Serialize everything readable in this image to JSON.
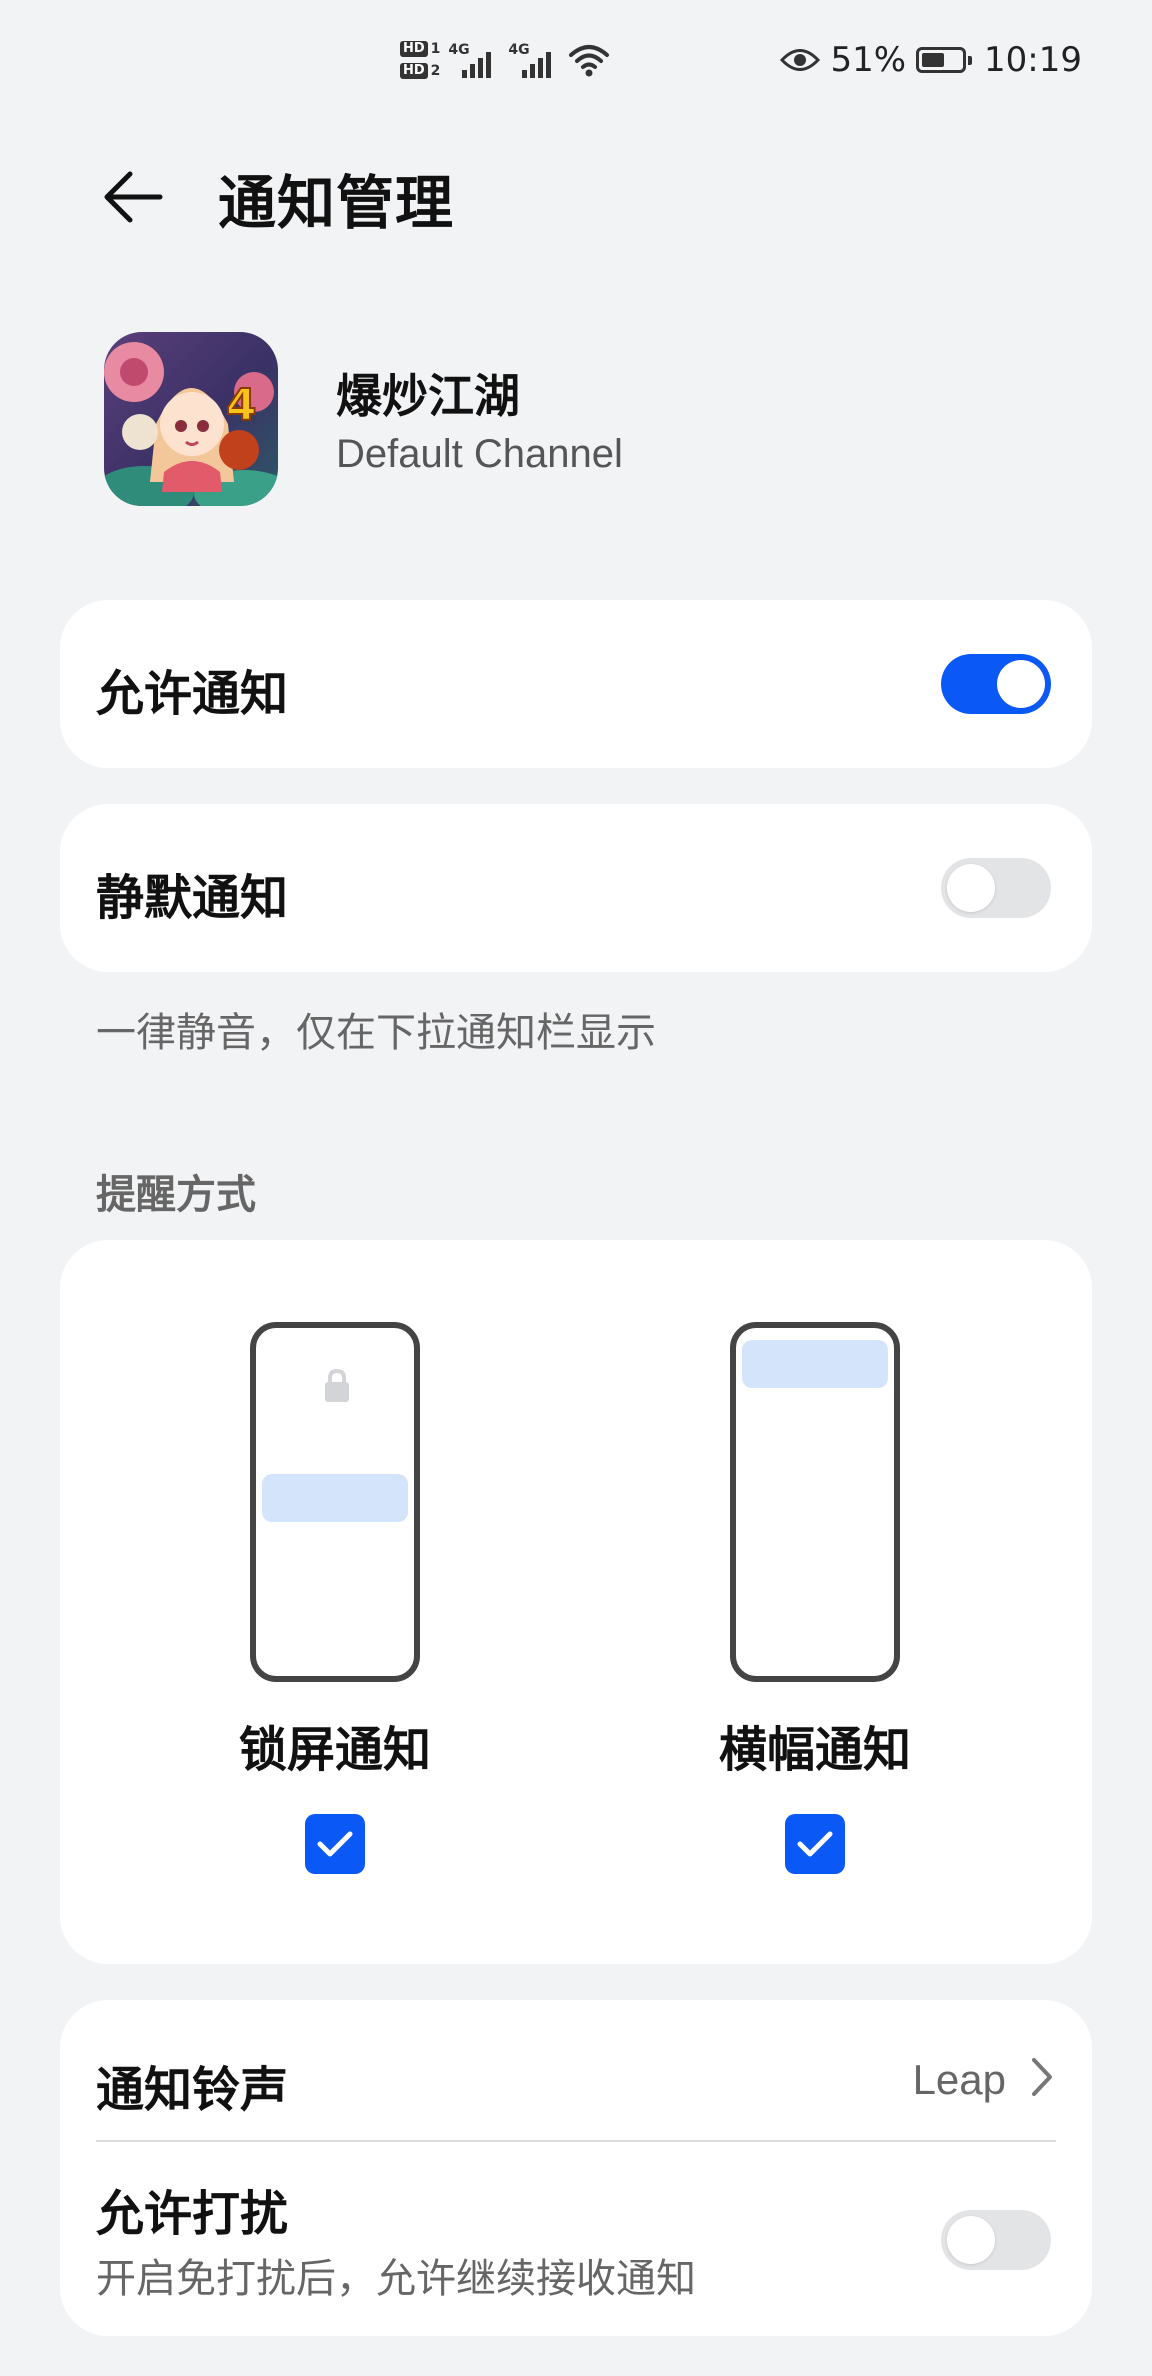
{
  "status_bar": {
    "sim1": "HD",
    "sim1_num": "1",
    "sim2": "HD",
    "sim2_num": "2",
    "network1": "4G",
    "network2": "4G",
    "battery_percent": "51%",
    "time": "10:19"
  },
  "header": {
    "title": "通知管理"
  },
  "app": {
    "name": "爆炒江湖",
    "channel": "Default Channel"
  },
  "allow_notifications": {
    "label": "允许通知",
    "enabled": true
  },
  "silent_notifications": {
    "label": "静默通知",
    "enabled": false,
    "hint": "一律静音，仅在下拉通知栏显示"
  },
  "alert_style": {
    "header": "提醒方式",
    "options": [
      {
        "label": "锁屏通知",
        "checked": true
      },
      {
        "label": "横幅通知",
        "checked": true
      }
    ]
  },
  "ringtone": {
    "label": "通知铃声",
    "value": "Leap"
  },
  "allow_dnd": {
    "label": "允许打扰",
    "sublabel": "开启免打扰后，允许继续接收通知",
    "enabled": false
  },
  "colors": {
    "accent": "#0a59f7",
    "background": "#f1f3f5",
    "card": "#ffffff",
    "banner_highlight": "#d4e5fb"
  }
}
